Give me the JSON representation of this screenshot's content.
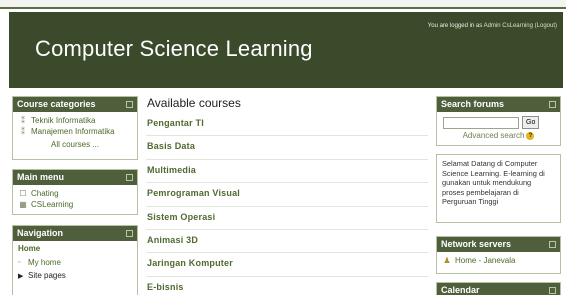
{
  "header": {
    "title": "Computer Science Learning",
    "login_prefix": "You are logged in as ",
    "login_user": "Admin CsLearning",
    "logout_label": "(Logout)"
  },
  "left": {
    "course_categories": {
      "title": "Course categories",
      "items": [
        {
          "label": "Teknik Informatika",
          "icon": "category-icon"
        },
        {
          "label": "Manajemen Informatika",
          "icon": "category-icon"
        }
      ],
      "all_courses": "All courses ..."
    },
    "main_menu": {
      "title": "Main menu",
      "items": [
        {
          "label": "Chating",
          "icon": "chat-icon"
        },
        {
          "label": "CSLearning",
          "icon": "page-icon"
        }
      ]
    },
    "navigation": {
      "title": "Navigation",
      "home": "Home",
      "items": [
        {
          "label": "My home",
          "bullet": "▫"
        },
        {
          "label": "Site pages",
          "bullet": "▶"
        }
      ]
    }
  },
  "main": {
    "heading": "Available courses",
    "courses": [
      "Pengantar TI",
      "Basis Data",
      "Multimedia",
      "Pemrograman Visual",
      "Sistem Operasi",
      "Animasi 3D",
      "Jaringan Komputer",
      "E-bisnis"
    ]
  },
  "right": {
    "search_forums": {
      "title": "Search forums",
      "input_value": "",
      "go_label": "Go",
      "advanced_label": "Advanced search"
    },
    "welcome_text": "Selamat Datang di Computer Science Learning. E-learning di gunakan untuk mendukung proses pembelajaran di Perguruan Tinggi",
    "network_servers": {
      "title": "Network servers",
      "item": "Home - Janevala"
    },
    "calendar": {
      "title": "Calendar"
    }
  },
  "colors": {
    "header_bg": "#3a4a2b",
    "block_header_bg": "#4f5f3c",
    "link": "#4c6a2a"
  }
}
